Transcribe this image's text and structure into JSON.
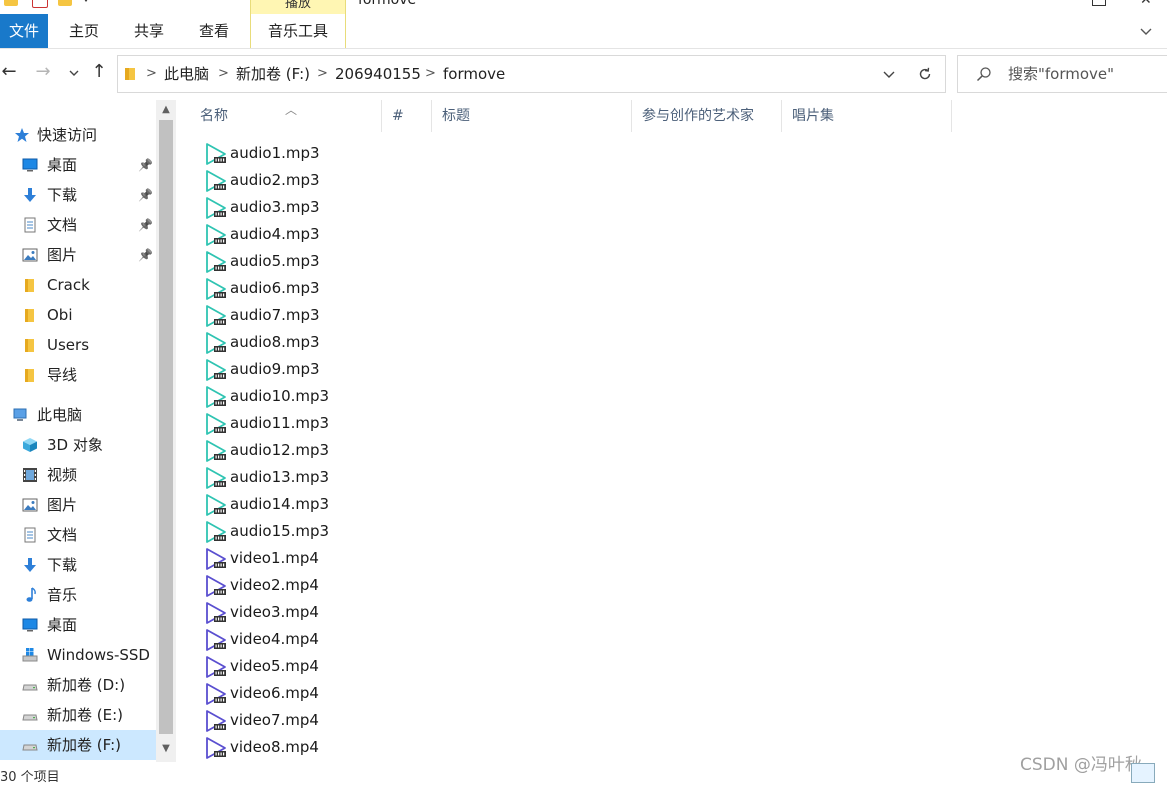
{
  "window": {
    "title": "formove",
    "context_tab": "播放"
  },
  "ribbon": {
    "tabs": [
      "文件",
      "主页",
      "共享",
      "查看",
      "音乐工具"
    ]
  },
  "address": {
    "crumbs": [
      "此电脑",
      "新加卷 (F:)",
      "206940155",
      "formove"
    ]
  },
  "search": {
    "placeholder": "搜索\"formove\""
  },
  "sidebar": {
    "quick_access": "快速访问",
    "quick_items": [
      {
        "label": "桌面",
        "icon": "desktop-icon",
        "pinned": true
      },
      {
        "label": "下载",
        "icon": "download-arrow-icon",
        "pinned": true
      },
      {
        "label": "文档",
        "icon": "document-icon",
        "pinned": true
      },
      {
        "label": "图片",
        "icon": "picture-icon",
        "pinned": true
      },
      {
        "label": "Crack",
        "icon": "folder-icon",
        "pinned": false
      },
      {
        "label": "Obi",
        "icon": "folder-icon",
        "pinned": false
      },
      {
        "label": "Users",
        "icon": "folder-icon",
        "pinned": false
      },
      {
        "label": "导线",
        "icon": "folder-icon",
        "pinned": false
      }
    ],
    "this_pc": "此电脑",
    "pc_items": [
      {
        "label": "3D 对象",
        "icon": "cube-3d-icon"
      },
      {
        "label": "视频",
        "icon": "video-film-icon"
      },
      {
        "label": "图片",
        "icon": "picture-icon"
      },
      {
        "label": "文档",
        "icon": "document-icon"
      },
      {
        "label": "下载",
        "icon": "download-arrow-icon"
      },
      {
        "label": "音乐",
        "icon": "music-note-icon"
      },
      {
        "label": "桌面",
        "icon": "desktop-icon"
      },
      {
        "label": "Windows-SSD (",
        "icon": "windows-drive-icon"
      },
      {
        "label": "新加卷 (D:)",
        "icon": "drive-icon"
      },
      {
        "label": "新加卷 (E:)",
        "icon": "drive-icon"
      },
      {
        "label": "新加卷 (F:)",
        "icon": "drive-icon",
        "selected": true
      }
    ]
  },
  "columns": [
    "名称",
    "#",
    "标题",
    "参与创作的艺术家",
    "唱片集"
  ],
  "files": [
    "audio1.mp3",
    "audio2.mp3",
    "audio3.mp3",
    "audio4.mp3",
    "audio5.mp3",
    "audio6.mp3",
    "audio7.mp3",
    "audio8.mp3",
    "audio9.mp3",
    "audio10.mp3",
    "audio11.mp3",
    "audio12.mp3",
    "audio13.mp3",
    "audio14.mp3",
    "audio15.mp3",
    "video1.mp4",
    "video2.mp4",
    "video3.mp4",
    "video4.mp4",
    "video5.mp4",
    "video6.mp4",
    "video7.mp4",
    "video8.mp4"
  ],
  "colors": {
    "accent": "#1979ca",
    "audio_icon": "#2fc4b2",
    "video_icon": "#5a4fd0",
    "selection": "#cce8ff",
    "context_tab": "#fff6b3"
  },
  "status": {
    "count": "30 个项目"
  },
  "watermark": "CSDN @冯叶秋"
}
